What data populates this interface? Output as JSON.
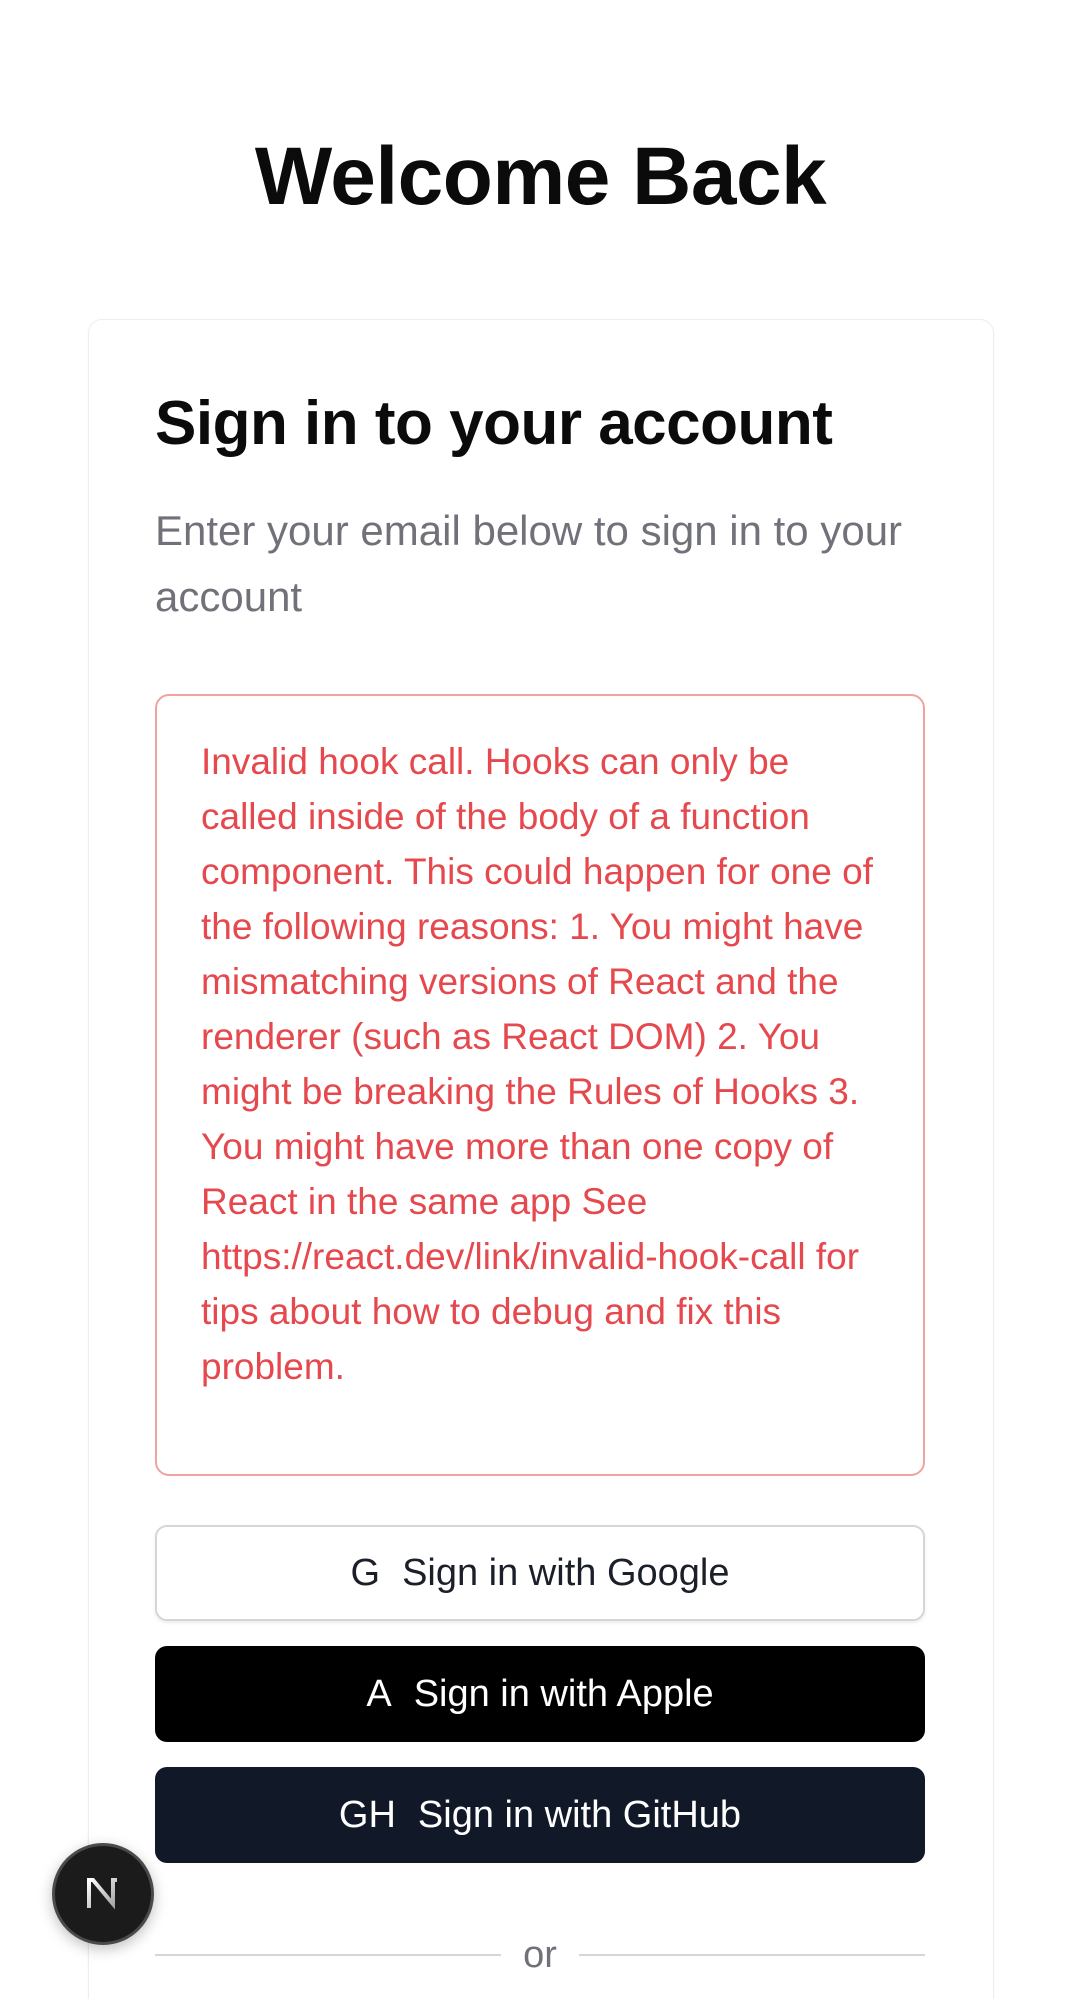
{
  "header": {
    "title": "Welcome Back"
  },
  "card": {
    "title": "Sign in to your account",
    "description": "Enter your email below to sign in to your account"
  },
  "error": {
    "message": "Invalid hook call. Hooks can only be called inside of the body of a function component. This could happen for one of the following reasons: 1. You might have mismatching versions of React and the renderer (such as React DOM) 2. You might be breaking the Rules of Hooks 3. You might have more than one copy of React in the same app See https://react.dev/link/invalid-hook-call for tips about how to debug and fix this problem."
  },
  "auth_buttons": [
    {
      "glyph": "G",
      "label": "Sign in with Google"
    },
    {
      "glyph": "A",
      "label": "Sign in with Apple"
    },
    {
      "glyph": "GH",
      "label": "Sign in with GitHub"
    }
  ],
  "divider": {
    "label": "or"
  },
  "dev_badge": {
    "icon": "nextjs-logo-icon"
  },
  "colors": {
    "error_text": "#e5484d",
    "error_border": "#f0a3a3",
    "apple_button": "#000000",
    "github_button": "#111827"
  }
}
